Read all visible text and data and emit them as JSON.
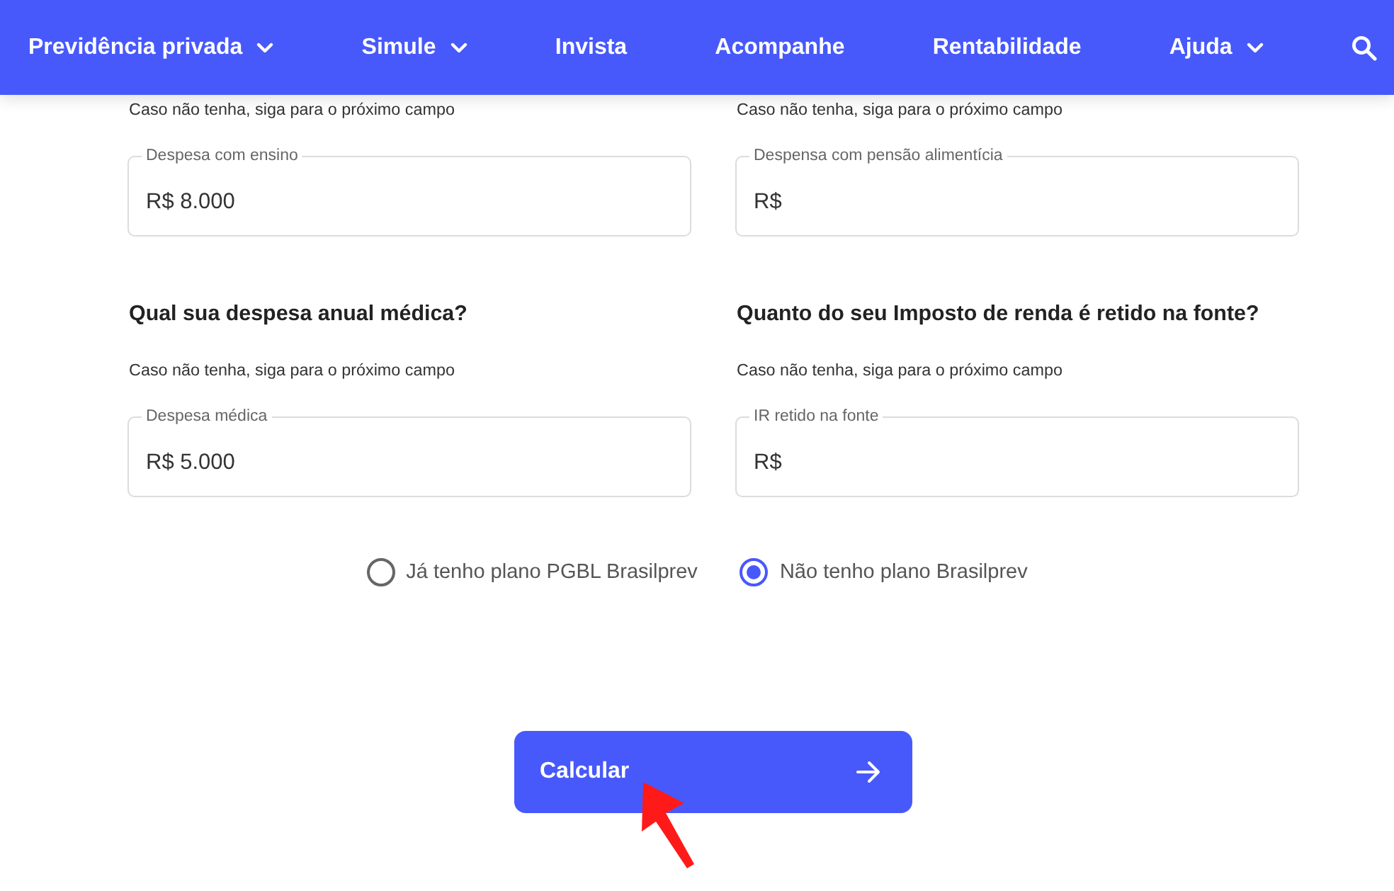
{
  "nav": {
    "items": [
      {
        "label": "Previdência privada",
        "has_menu": true
      },
      {
        "label": "Simule",
        "has_menu": true
      },
      {
        "label": "Invista",
        "has_menu": false
      },
      {
        "label": "Acompanhe",
        "has_menu": false
      },
      {
        "label": "Rentabilidade",
        "has_menu": false
      },
      {
        "label": "Ajuda",
        "has_menu": true
      }
    ]
  },
  "fields": [
    {
      "hint": "Caso não tenha, siga para o próximo campo",
      "label": "Despesa com ensino",
      "value": "R$ 8.000"
    },
    {
      "hint": "Caso não tenha, siga para o próximo campo",
      "label": "Despensa com pensão alimentícia",
      "value": "R$"
    },
    {
      "question": "Qual sua despesa anual médica?",
      "hint": "Caso não tenha, siga para o próximo campo",
      "label": "Despesa médica",
      "value": "R$ 5.000"
    },
    {
      "question": "Quanto do seu Imposto de renda é retido na fonte?",
      "hint": "Caso não tenha, siga para o próximo campo",
      "label": "IR retido na fonte",
      "value": "R$"
    }
  ],
  "plan_options": [
    {
      "label": "Já tenho plano PGBL Brasilprev",
      "selected": false
    },
    {
      "label": "Não tenho plano Brasilprev",
      "selected": true
    }
  ],
  "submit_button": {
    "label": "Calcular"
  },
  "annotation": {
    "kind": "arrow"
  }
}
